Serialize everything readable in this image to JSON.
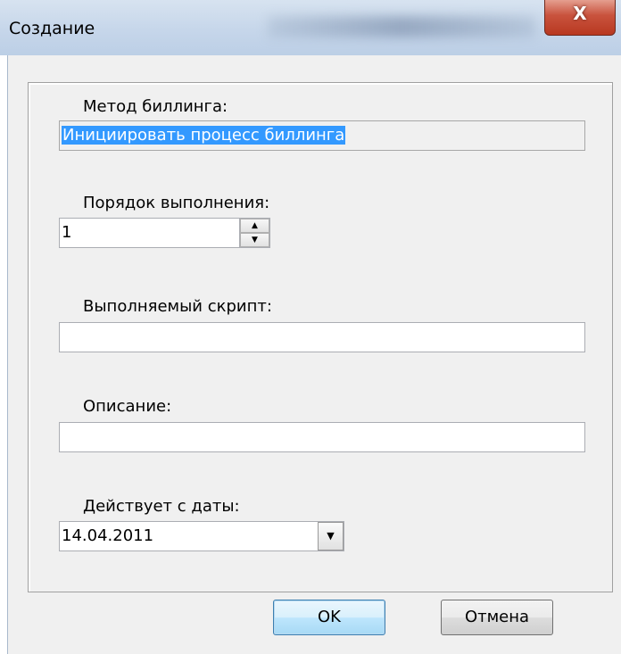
{
  "window": {
    "title": "Создание",
    "close_glyph": "X"
  },
  "form": {
    "billing_method": {
      "label": "Метод биллинга:",
      "value": "Инициировать процесс биллинга"
    },
    "execution_order": {
      "label": "Порядок выполнения:",
      "value": "1"
    },
    "script": {
      "label": "Выполняемый скрипт:",
      "value": ""
    },
    "description": {
      "label": "Описание:",
      "value": ""
    },
    "effective_date": {
      "label": "Действует с даты:",
      "value": "14.04.2011"
    }
  },
  "buttons": {
    "ok": "OK",
    "cancel": "Отмена"
  },
  "icons": {
    "spin_up": "up-arrow-icon",
    "spin_down": "down-arrow-icon",
    "dropdown": "chevron-down-icon"
  }
}
